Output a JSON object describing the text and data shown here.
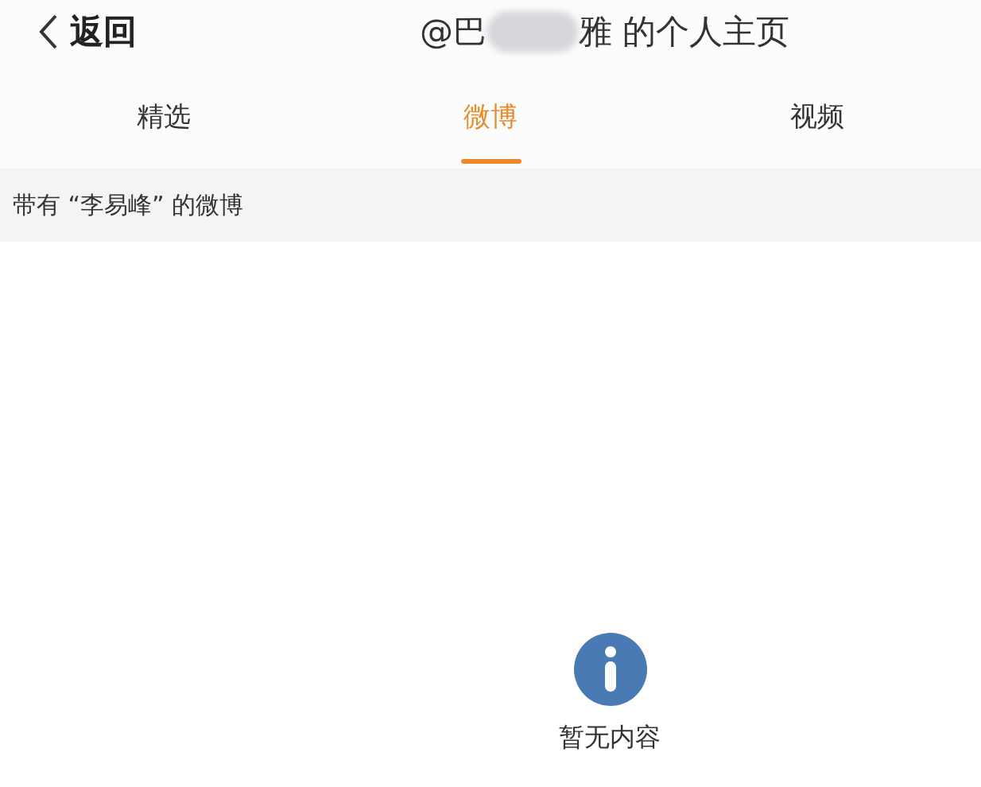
{
  "header": {
    "back_label": "返回",
    "title_start": "@巴",
    "title_end": "雅 的个人主页"
  },
  "tabs": [
    {
      "label": "精选",
      "selected": false
    },
    {
      "label": "微博",
      "selected": true
    },
    {
      "label": "视频",
      "selected": false
    }
  ],
  "filter": {
    "text": "带有 “李易峰” 的微博"
  },
  "empty_state": {
    "message": "暂无内容"
  }
}
